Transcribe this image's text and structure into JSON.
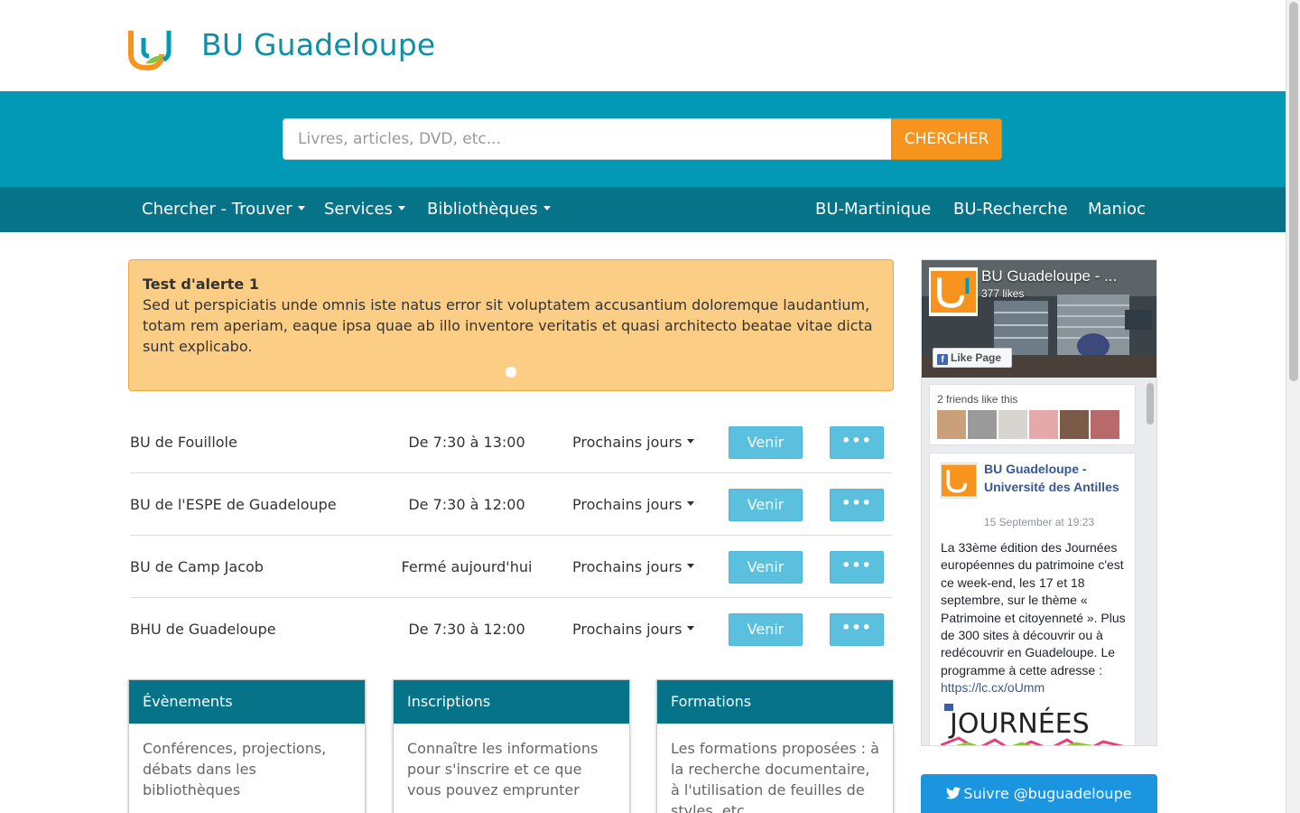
{
  "header": {
    "title": "BU Guadeloupe"
  },
  "search": {
    "placeholder": "Livres, articles, DVD, etc...",
    "button_label": "CHERCHER"
  },
  "nav": {
    "left": [
      "Chercher - Trouver",
      "Services",
      "Bibliothèques"
    ],
    "right": [
      "BU-Martinique",
      "BU-Recherche",
      "Manioc"
    ]
  },
  "alert": {
    "title": "Test d'alerte 1",
    "body": "Sed ut perspiciatis unde omnis iste natus error sit voluptatem accusantium doloremque laudantium, totam rem aperiam, eaque ipsa quae ab illo inventore veritatis et quasi architecto beatae vitae dicta sunt explicabo."
  },
  "libraries": [
    {
      "name": "BU de Fouillole",
      "hours": "De 7:30 à 13:00",
      "days_label": "Prochains jours",
      "venir_label": "Venir",
      "more_label": "•••"
    },
    {
      "name": "BU de l'ESPE de Guadeloupe",
      "hours": "De 7:30 à 12:00",
      "days_label": "Prochains jours",
      "venir_label": "Venir",
      "more_label": "•••"
    },
    {
      "name": "BU de Camp Jacob",
      "hours": "Fermé aujourd'hui",
      "days_label": "Prochains jours",
      "venir_label": "Venir",
      "more_label": "•••"
    },
    {
      "name": "BHU de Guadeloupe",
      "hours": "De 7:30 à 12:00",
      "days_label": "Prochains jours",
      "venir_label": "Venir",
      "more_label": "•••"
    }
  ],
  "panels": [
    {
      "title": "Évènements",
      "body": "Conférences, projections, débats dans les bibliothèques"
    },
    {
      "title": "Inscriptions",
      "body": "Connaître les informations pour s'inscrire et ce que vous pouvez emprunter"
    },
    {
      "title": "Formations",
      "body": "Les formations proposées : à la recherche documentaire, à l'utilisation de feuilles de styles, etc"
    }
  ],
  "facebook": {
    "page_name": "BU Guadeloupe - ...",
    "likes": "377 likes",
    "like_button": "Like Page",
    "friends_text": "2 friends like this",
    "post": {
      "author": "BU Guadeloupe - Université des Antilles",
      "time": "15 September at 19:23",
      "text": "La 33ème édition des Journées européennes du patrimoine c'est ce week-end, les 17 et 18 septembre, sur le thème « Patrimoine et citoyenneté ». Plus de 300 sites à découvrir ou à redécouvrir en Guadeloupe. Le programme à cette adresse :",
      "link": "https://lc.cx/oUmm",
      "image_text": "JOURNÉES"
    }
  },
  "twitter": {
    "follow_label": "Suivre @buguadeloupe"
  },
  "colors": {
    "brand": "#0199b5",
    "nav": "#067389",
    "accent": "#f7941d",
    "alert": "#fcce85",
    "button": "#5bc0de",
    "twitter": "#1b95e0"
  }
}
